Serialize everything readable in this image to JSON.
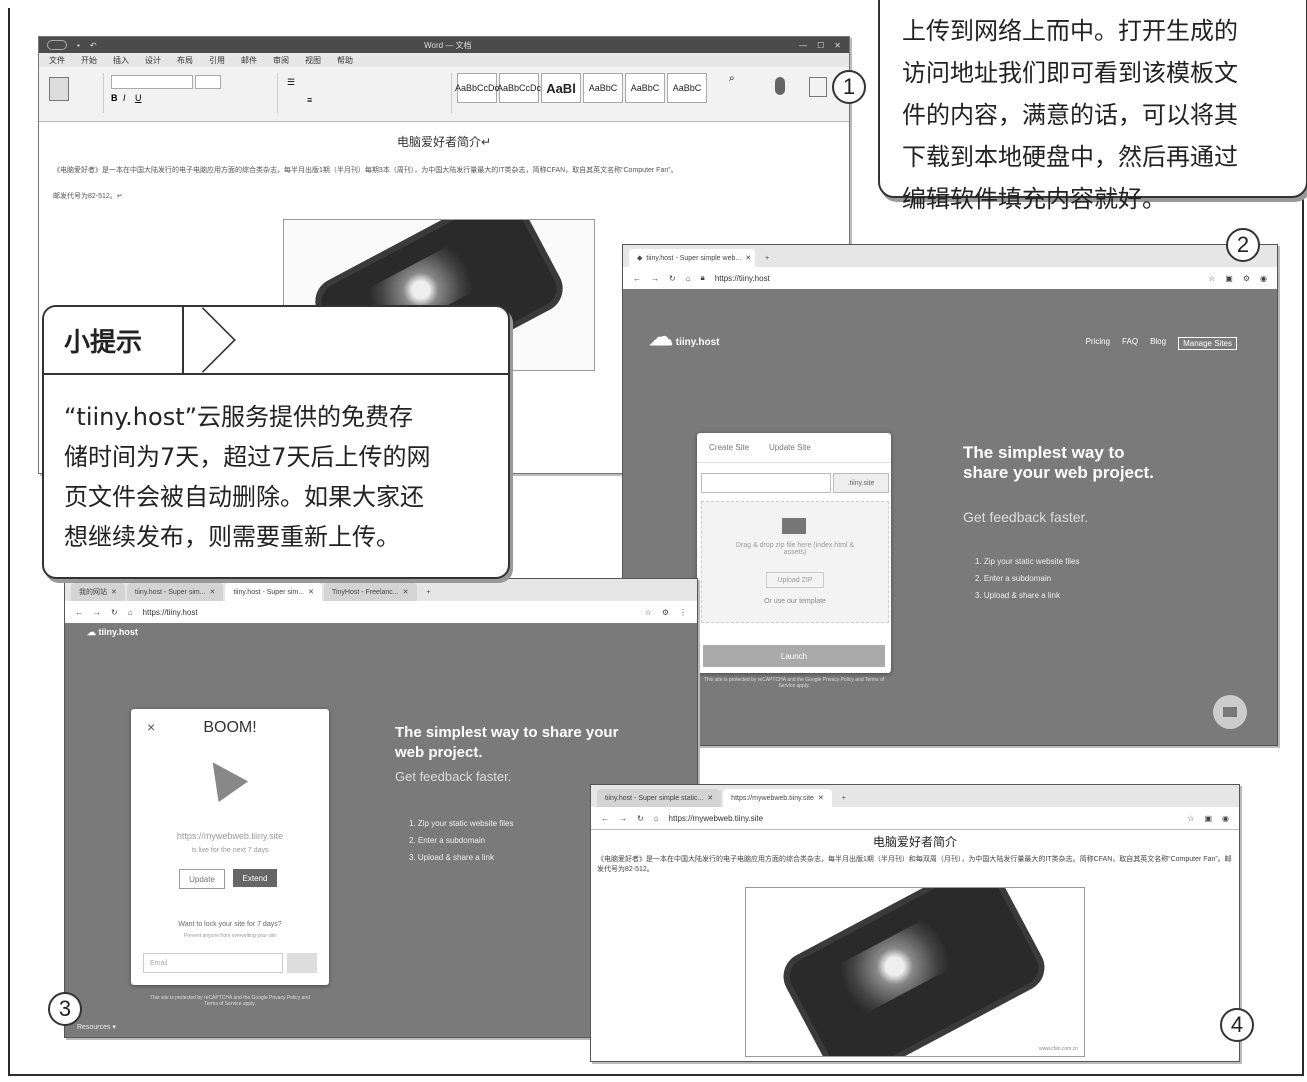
{
  "callout_text": {
    "line1": "上传到网络上而中。打开生成的",
    "line2": "访问地址我们即可看到该模板文",
    "line3": "件的内容，满意的话，可以将其",
    "line4": "下载到本地硬盘中，然后再通过",
    "line5": "编辑软件填充内容就好。"
  },
  "tip": {
    "title": "小提示",
    "lines": [
      "“tiiny.host”云服务提供的免费存",
      "储时间为7天，超过7天后上传的网",
      "页文件会被自动删除。如果大家还",
      "想继续发布，则需要重新上传。"
    ]
  },
  "badges": [
    "1",
    "2",
    "3",
    "4"
  ],
  "word_window": {
    "title": "Word — 文档",
    "menu": [
      "文件",
      "开始",
      "插入",
      "设计",
      "布局",
      "引用",
      "邮件",
      "审阅",
      "视图",
      "帮助"
    ],
    "styles": [
      "AaBbCcDc",
      "AaBbCcDc",
      "AaBl",
      "AaBbC",
      "AaBbC",
      "AaBbC"
    ],
    "doc_title": "电脑爱好者简介↵",
    "doc_body": "《电脑爱好者》是一本在中国大陆发行的电子电脑应用方面的综合类杂志，每半月出版1期（半月刊）每期3本（周刊），为中国大陆发行量最大的IT类杂志，简称CFAN，取自其英文名称“Computer Fan”。",
    "doc_foot": "邮发代号为82-512。↵"
  },
  "browser2": {
    "tab_label": "tiiny.host - Super simple web...",
    "url": "https://tiiny.host",
    "logo": "tiiny.host",
    "nav": [
      "Pricing",
      "FAQ",
      "Blog",
      "Manage Sites"
    ],
    "card_tabs": [
      "Create Site",
      "Update Site"
    ],
    "subdomain_suffix": ".tiiny.site",
    "drop_text": "Drag & drop zip file here (index.html & assets)",
    "upload_btn": "Upload ZIP",
    "template_link": "Or use our template",
    "launch_btn": "Launch",
    "recaptcha": "This site is protected by reCAPTCHA and the Google Privacy Policy and Terms of Service apply.",
    "headline": "The simplest way to share your web project.",
    "subhead": "Get feedback faster.",
    "steps": [
      "1. Zip your static website files",
      "2. Enter a subdomain",
      "3. Upload & share a link"
    ]
  },
  "browser3": {
    "tabs": [
      "我的网站",
      "tiiny.host - Super sim...",
      "tiiny.host - Super sim...",
      "TinyHost - Freelanc..."
    ],
    "url": "https://tiiny.host",
    "logo": "tiiny.host",
    "modal_title": "BOOM!",
    "site_url": "https://mywebweb.tiiny.site",
    "live_text": "is live for the next 7 days",
    "update_btn": "Update",
    "extend_btn": "Extend",
    "lock_question": "Want to lock your site for 7 days?",
    "lock_sub": "Prevent anyone from overwriting your site",
    "email_placeholder": "Email",
    "recaptcha": "This site is protected by reCAPTCHA and the Google Privacy Policy and Terms of Service apply.",
    "headline": "The simplest way to share your web project.",
    "subhead": "Get feedback faster.",
    "steps": [
      "1. Zip your static website files",
      "2. Enter a subdomain",
      "3. Upload & share a link"
    ],
    "resources": "Resources ▾"
  },
  "browser4": {
    "tabs": [
      "tiiny.host - Super simple static...",
      "https://mywebweb.tiiny.site"
    ],
    "url": "https://mywebweb.tiiny.site",
    "doc_title": "电脑爱好者简介",
    "doc_body": "《电脑爱好者》是一本在中国大陆发行的电子电脑应用方面的综合类杂志，每半月出版1期（半月刊）和每双周（月刊），为中国大陆发行量最大的IT类杂志。简称CFAN，取自其英文名称“Computer Fan”。邮发代号为82-512。",
    "watermark": "www.cfan.com.cn"
  },
  "colors": {
    "page_grey": "#7a7a7a",
    "frame": "#2b2b2b"
  }
}
